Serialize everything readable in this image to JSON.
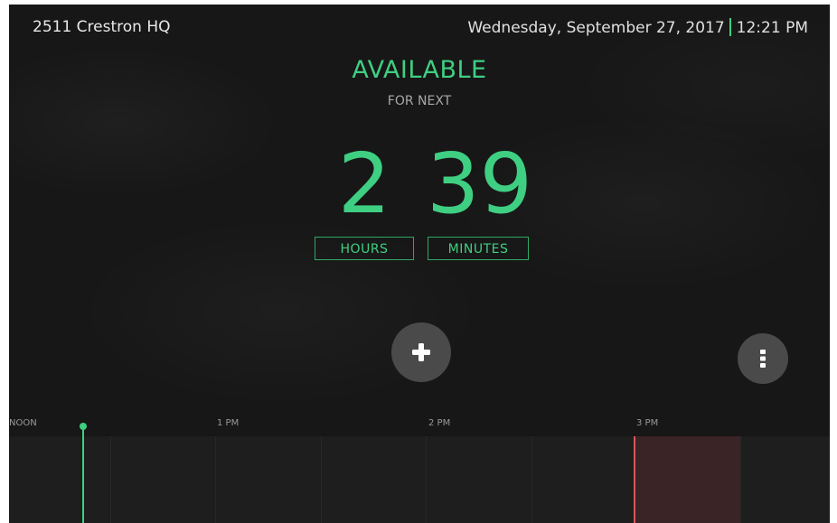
{
  "header": {
    "room_name": "2511 Crestron HQ",
    "date": "Wednesday, September 27, 2017",
    "time": "12:21 PM"
  },
  "status": {
    "label": "AVAILABLE",
    "sub_label": "FOR NEXT",
    "hours_value": "2",
    "minutes_value": "39",
    "hours_unit": "HOURS",
    "minutes_unit": "MINUTES"
  },
  "actions": {
    "add_icon": "plus-icon",
    "more_icon": "vertical-ellipsis-icon"
  },
  "timeline": {
    "labels": [
      "NOON",
      "1 PM",
      "2 PM",
      "3 PM"
    ],
    "current_time": "12:21 PM",
    "reservation": {
      "start": "3:00 PM",
      "end": "3:30 PM"
    }
  },
  "colors": {
    "accent": "#3fcf82",
    "reserved": "#d8575c",
    "background": "#171717"
  }
}
